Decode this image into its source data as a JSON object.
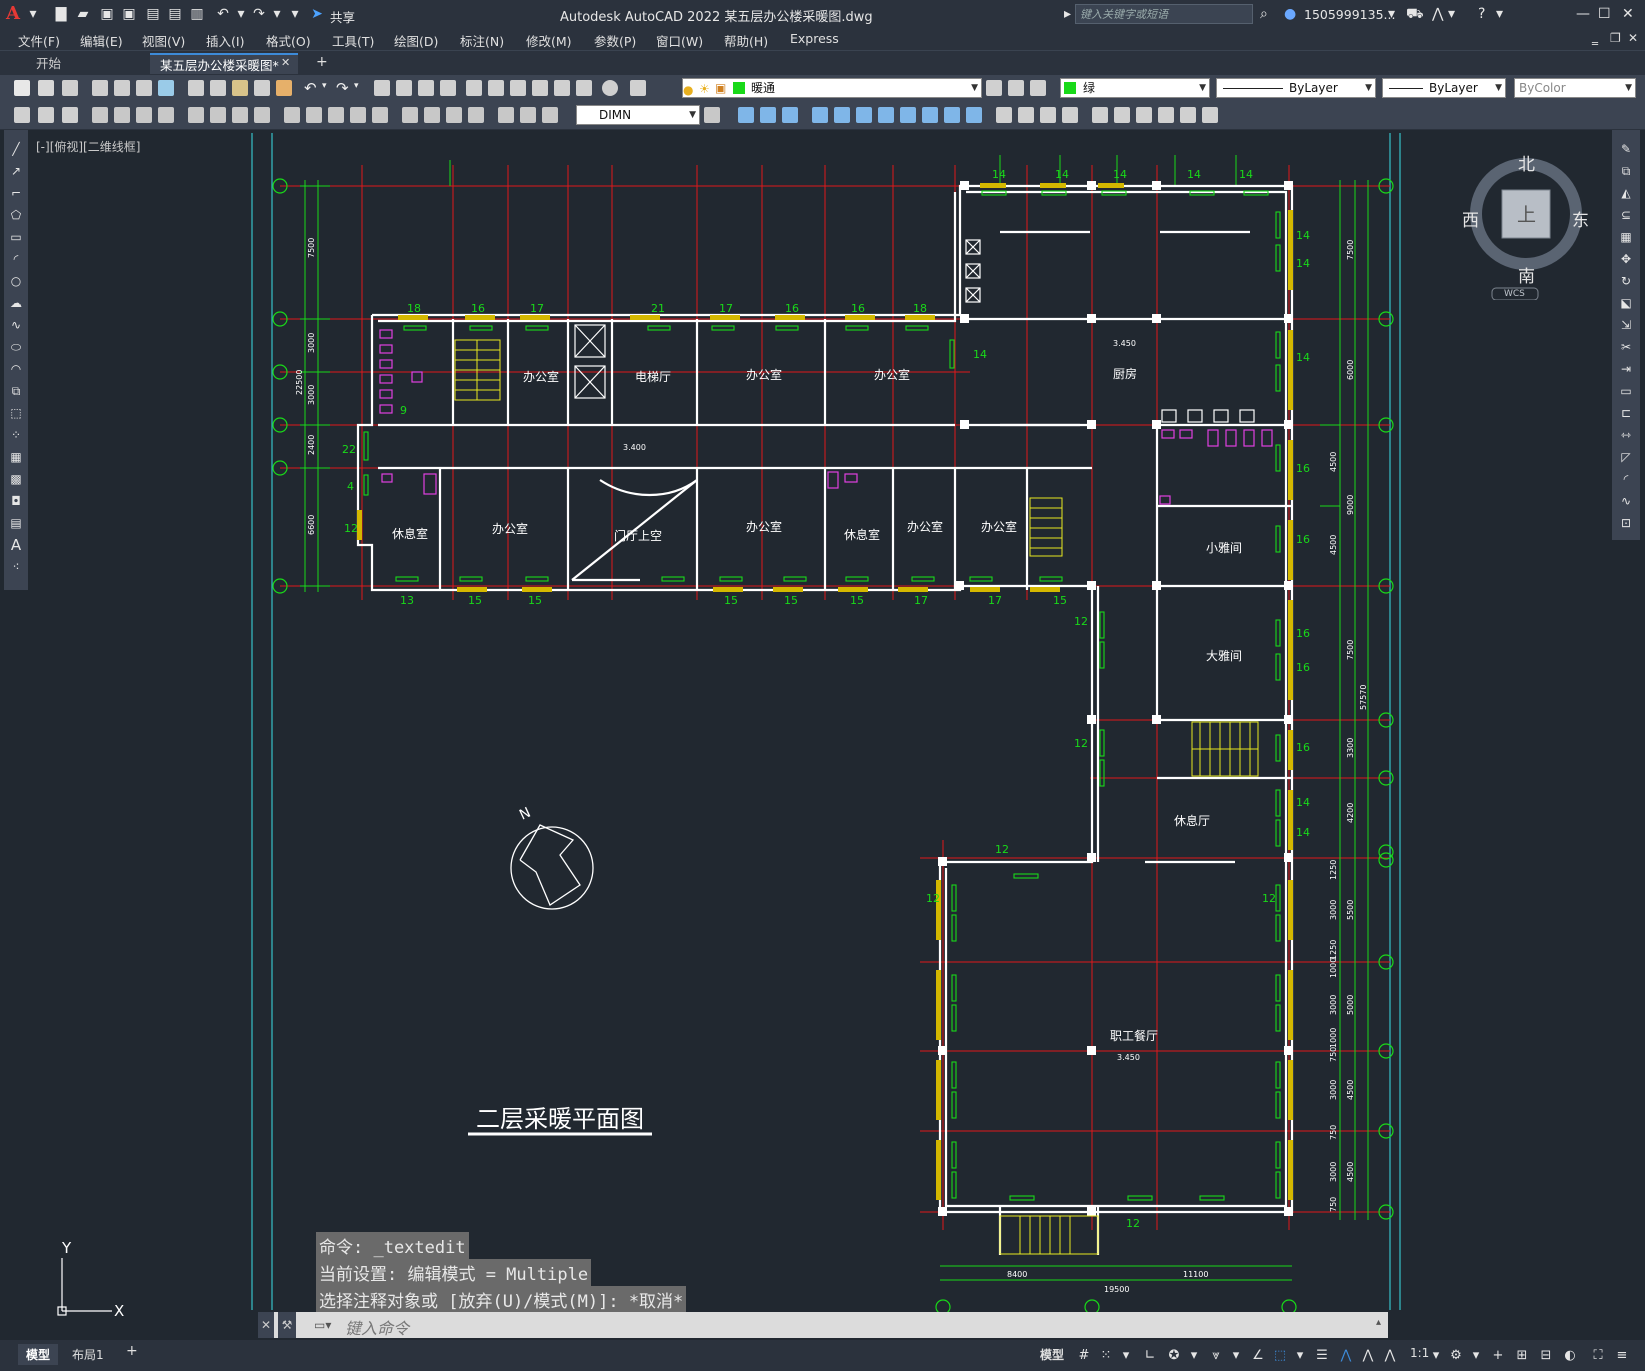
{
  "app": {
    "title": "Autodesk AutoCAD 2022   某五层办公楼采暖图.dwg",
    "share_label": "共享",
    "search_placeholder": "键入关键字或短语",
    "user": "1505999135...",
    "logo": "A"
  },
  "menu": [
    "文件(F)",
    "编辑(E)",
    "视图(V)",
    "插入(I)",
    "格式(O)",
    "工具(T)",
    "绘图(D)",
    "标注(N)",
    "修改(M)",
    "参数(P)",
    "窗口(W)",
    "帮助(H)",
    "Express"
  ],
  "tabs": {
    "start": "开始",
    "active": "某五层办公楼采暖图*",
    "close": "✕",
    "add": "+"
  },
  "properties": {
    "layer": "暖通",
    "color": "绿",
    "linetype": "ByLayer",
    "lineweight": "ByLayer",
    "plotstyle": "ByColor",
    "dimstyle": "DIMN"
  },
  "viewport": {
    "label": "[-][俯视][二维线框]"
  },
  "viewcube": {
    "north": "北",
    "south": "南",
    "east": "东",
    "west": "西",
    "top": "上",
    "wcs": "WCS"
  },
  "drawing": {
    "title": "二层采暖平面图",
    "north_label": "N",
    "rooms": [
      "办公室",
      "电梯厅",
      "办公室",
      "办公室",
      "厨房",
      "休息室",
      "办公室",
      "门厅上空",
      "办公室",
      "休息室",
      "办公室",
      "办公室",
      "小雅间",
      "大雅间",
      "休息厅",
      "职工餐厅"
    ],
    "elevations": [
      "3.450",
      "3.400",
      "3.450"
    ],
    "dims_left": [
      "7500",
      "3000",
      "3000",
      "2400",
      "6600",
      "22500"
    ],
    "dims_right": [
      "7500",
      "6000",
      "4500",
      "4500",
      "9000",
      "7500",
      "3300",
      "4200",
      "57570",
      "1250",
      "3000",
      "5500",
      "1250",
      "1000",
      "3000",
      "5000",
      "750",
      "1000",
      "3000",
      "4500",
      "750",
      "3000",
      "750",
      "4500"
    ],
    "dims_bottom": [
      "8400",
      "11100",
      "19500"
    ],
    "radiator_counts_top": [
      "18",
      "16",
      "17",
      "21",
      "17",
      "16",
      "16",
      "18",
      "14",
      "14",
      "14",
      "14",
      "14"
    ],
    "radiator_counts_bottom": [
      "13",
      "15",
      "15",
      "15",
      "15",
      "15",
      "17",
      "17",
      "15"
    ],
    "radiator_counts_misc": [
      "22",
      "4",
      "12",
      "9",
      "14",
      "14",
      "14",
      "14",
      "16",
      "16",
      "16",
      "16",
      "16",
      "14",
      "14",
      "12",
      "12",
      "12",
      "12",
      "12",
      "12"
    ]
  },
  "ucs": {
    "x": "X",
    "y": "Y"
  },
  "command": {
    "history": [
      "命令: _textedit",
      "当前设置: 编辑模式 = Multiple",
      "选择注释对象或 [放弃(U)/模式(M)]: *取消*"
    ],
    "placeholder": "键入命令"
  },
  "status": {
    "model_tab": "模型",
    "layout_tab": "布局1",
    "add_tab": "+",
    "model_button": "模型",
    "scale": "1:1"
  },
  "colors": {
    "background": "#212830",
    "grid_red": "#e0181a",
    "dim_green": "#19d919",
    "wall": "#ffffff",
    "fixture": "#e040e0",
    "stair": "#e8e820",
    "cyan": "#36c0c8"
  }
}
